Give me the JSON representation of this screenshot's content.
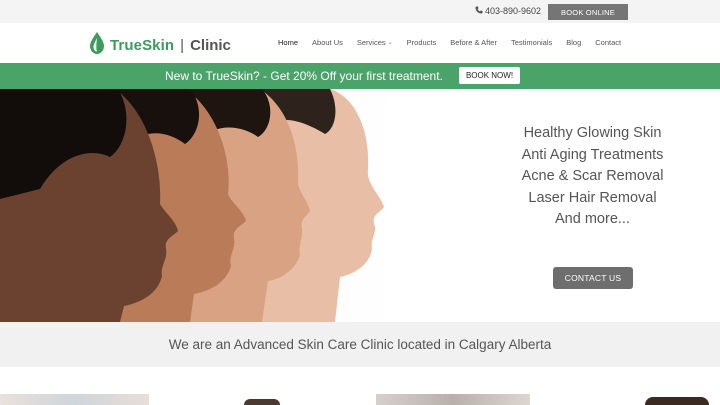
{
  "topbar": {
    "phone": "403-890-9602",
    "book_online": "BOOK ONLINE"
  },
  "header": {
    "logo_brand": "TrueSkin",
    "logo_separator": "|",
    "logo_suffix": "Clinic",
    "nav": [
      {
        "label": "Home",
        "active": true
      },
      {
        "label": "About Us"
      },
      {
        "label": "Services",
        "has_dropdown": true
      },
      {
        "label": "Products"
      },
      {
        "label": "Before & After"
      },
      {
        "label": "Testimonials"
      },
      {
        "label": "Blog"
      },
      {
        "label": "Contact"
      }
    ]
  },
  "promo": {
    "text": "New to TrueSkin? - Get 20% Off your first treatment.",
    "button": "BOOK NOW!"
  },
  "hero": {
    "services": [
      "Healthy Glowing Skin",
      "Anti Aging Treatments",
      "Acne & Scar Removal",
      "Laser Hair Removal",
      "And more..."
    ],
    "contact_button": "CONTACT US"
  },
  "tagline": "We are an Advanced Skin Care Clinic located in Calgary Alberta",
  "colors": {
    "brand_green": "#4aa46a",
    "button_gray": "#6e6e6e",
    "topbar_bg": "#f4f4f4",
    "tagline_bg": "#f1f1f1"
  }
}
